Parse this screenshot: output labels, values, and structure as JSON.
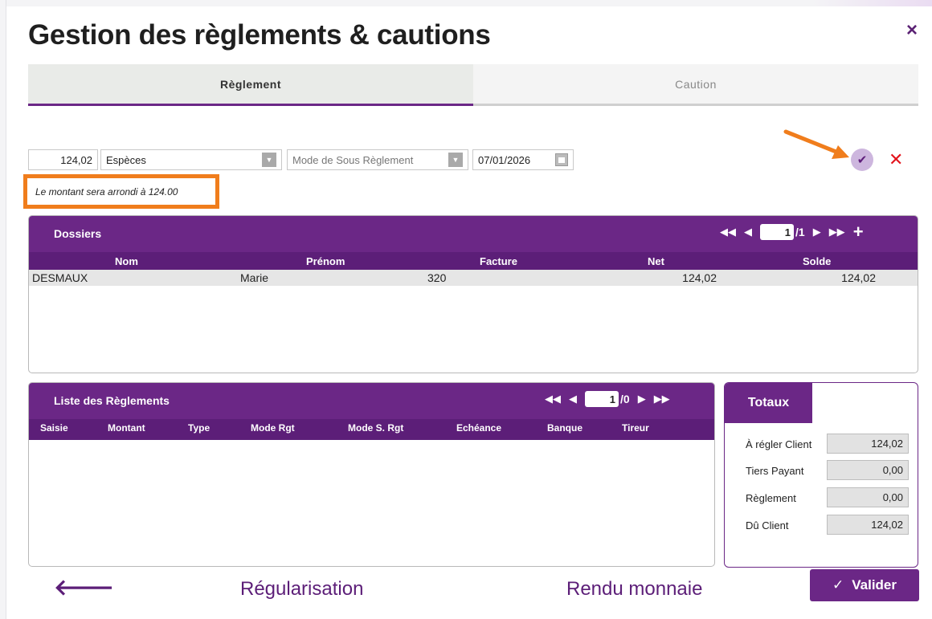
{
  "dialog": {
    "title": "Gestion des règlements & cautions",
    "close_symbol": "×"
  },
  "tabs": [
    {
      "label": "Règlement",
      "active": true
    },
    {
      "label": "Caution",
      "active": false
    }
  ],
  "form": {
    "amount": "124,02",
    "payment_type": "Espèces",
    "sub_mode_placeholder": "Mode de Sous Règlement",
    "date": "07/01/2026",
    "note": "Le montant sera arrondi à 124.00"
  },
  "actions": {
    "confirm_icon": "check-icon",
    "cancel_symbol": "✕"
  },
  "dossiers": {
    "title": "Dossiers",
    "page_current": "1",
    "page_total": "/1",
    "columns": [
      "Nom",
      "Prénom",
      "Facture",
      "Net",
      "Solde"
    ],
    "rows": [
      {
        "nom": "DESMAUX",
        "prenom": "Marie",
        "facture": "320",
        "net": "124,02",
        "solde": "124,02"
      }
    ]
  },
  "reglements": {
    "title": "Liste des Règlements",
    "page_current": "1",
    "page_total": "/0",
    "columns": [
      "Saisie",
      "Montant",
      "Type",
      "Mode Rgt",
      "Mode S. Rgt",
      "Echéance",
      "Banque",
      "Tireur"
    ]
  },
  "totaux": {
    "title": "Totaux",
    "rows": [
      {
        "label": "À régler Client",
        "value": "124,02"
      },
      {
        "label": "Tiers Payant",
        "value": "0,00"
      },
      {
        "label": "Règlement",
        "value": "0,00"
      },
      {
        "label": "Dû Client",
        "value": "124,02"
      }
    ]
  },
  "footer": {
    "back_symbol": "🡐",
    "regularisation": "Régularisation",
    "rendu_monnaie": "Rendu monnaie",
    "valider": "Valider"
  },
  "colors": {
    "brand_purple": "#6b2786",
    "dark_purple": "#5c1e78",
    "highlight_orange": "#f07d1c",
    "cancel_red": "#e3141c"
  }
}
